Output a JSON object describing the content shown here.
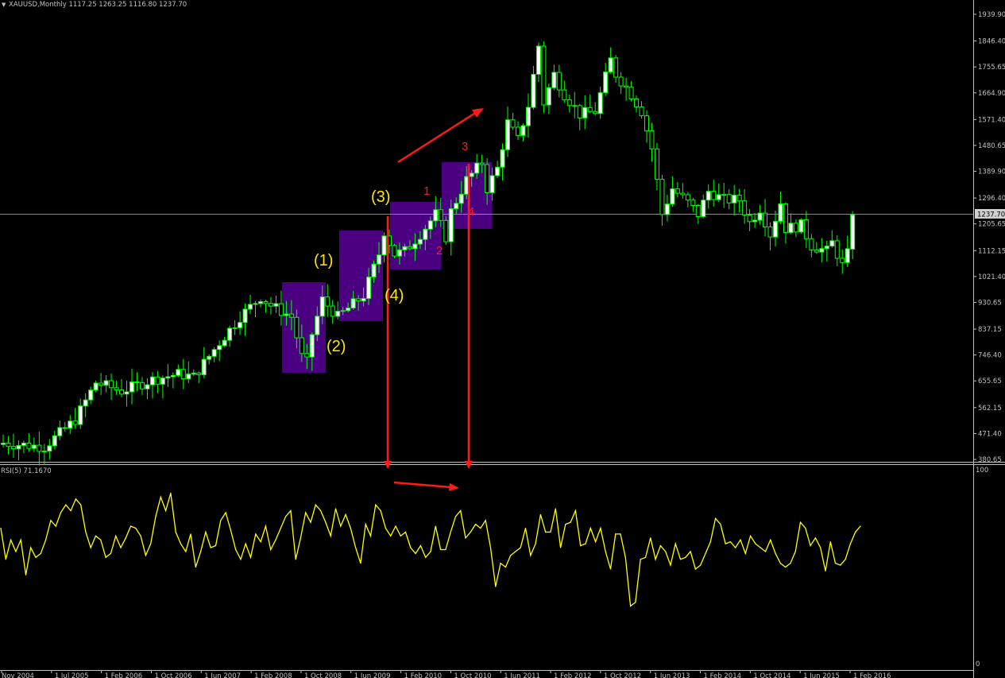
{
  "window": {
    "symbol_header": "XAUUSD,Monthly  1117.25 1263.25 1116.80 1237.70",
    "indicator_header": "RSI(5) 71.1670"
  },
  "colors": {
    "background": "#000000",
    "bull_candle": "#ffffff",
    "bear_candle": "#000000",
    "wick": "#00ff00",
    "rsi_line": "#ffff00",
    "annotation_red": "#ff1a1a",
    "annotation_yellow": "#ffe600",
    "box_fill": "#4b0082",
    "price_line": "#7d8c96",
    "axis": "#c0c0c0"
  },
  "chart_data": [
    {
      "type": "candlestick",
      "title": "XAUUSD,Monthly",
      "last_price": "1237.70",
      "price_labels": [
        "1939.90",
        "1846.40",
        "1755.65",
        "1664.90",
        "1571.40",
        "1480.65",
        "1389.90",
        "1296.40",
        "1205.65",
        "1112.15",
        "1021.40",
        "930.65",
        "837.15",
        "746.40",
        "655.65",
        "562.15",
        "471.40",
        "380.65"
      ],
      "x_labels": [
        "Nov 2004",
        "1 Jul 2005",
        "1 Feb 2006",
        "1 Oct 2006",
        "1 Jun 2007",
        "1 Feb 2008",
        "1 Oct 2008",
        "1 Jun 2009",
        "1 Feb 2010",
        "1 Oct 2010",
        "1 Jun 2011",
        "1 Feb 2012",
        "1 Oct 2012",
        "1 Jun 2013",
        "1 Feb 2014",
        "1 Oct 2014",
        "1 Jun 2015",
        "1 Feb 2016"
      ],
      "close_path": [
        {
          "m": 0,
          "v": 438
        },
        {
          "m": 8,
          "v": 425
        },
        {
          "m": 14,
          "v": 520
        },
        {
          "m": 18,
          "v": 650
        },
        {
          "m": 23,
          "v": 620
        },
        {
          "m": 29,
          "v": 660
        },
        {
          "m": 34,
          "v": 680
        },
        {
          "m": 37,
          "v": 670
        },
        {
          "m": 42,
          "v": 790
        },
        {
          "m": 46,
          "v": 880
        },
        {
          "m": 50,
          "v": 950
        },
        {
          "m": 52,
          "v": 920
        },
        {
          "m": 54,
          "v": 900
        },
        {
          "m": 56,
          "v": 880
        },
        {
          "m": 58,
          "v": 740
        },
        {
          "m": 59,
          "v": 720
        },
        {
          "m": 60,
          "v": 820
        },
        {
          "m": 62,
          "v": 940
        },
        {
          "m": 65,
          "v": 880
        },
        {
          "m": 70,
          "v": 955
        },
        {
          "m": 73,
          "v": 1100
        },
        {
          "m": 74,
          "v": 1180
        },
        {
          "m": 76,
          "v": 1100
        },
        {
          "m": 78,
          "v": 1110
        },
        {
          "m": 81,
          "v": 1170
        },
        {
          "m": 84,
          "v": 1240
        },
        {
          "m": 86,
          "v": 1160
        },
        {
          "m": 87,
          "v": 1250
        },
        {
          "m": 90,
          "v": 1360
        },
        {
          "m": 93,
          "v": 1420
        },
        {
          "m": 94,
          "v": 1330
        },
        {
          "m": 96,
          "v": 1400
        },
        {
          "m": 98,
          "v": 1560
        },
        {
          "m": 100,
          "v": 1500
        },
        {
          "m": 102,
          "v": 1620
        },
        {
          "m": 104,
          "v": 1830
        },
        {
          "m": 105,
          "v": 1630
        },
        {
          "m": 107,
          "v": 1730
        },
        {
          "m": 109,
          "v": 1660
        },
        {
          "m": 112,
          "v": 1590
        },
        {
          "m": 115,
          "v": 1600
        },
        {
          "m": 118,
          "v": 1780
        },
        {
          "m": 119,
          "v": 1730
        },
        {
          "m": 122,
          "v": 1660
        },
        {
          "m": 124,
          "v": 1600
        },
        {
          "m": 126,
          "v": 1470
        },
        {
          "m": 128,
          "v": 1240
        },
        {
          "m": 130,
          "v": 1330
        },
        {
          "m": 133,
          "v": 1280
        },
        {
          "m": 135,
          "v": 1240
        },
        {
          "m": 137,
          "v": 1320
        },
        {
          "m": 140,
          "v": 1290
        },
        {
          "m": 143,
          "v": 1290
        },
        {
          "m": 145,
          "v": 1210
        },
        {
          "m": 147,
          "v": 1260
        },
        {
          "m": 149,
          "v": 1170
        },
        {
          "m": 151,
          "v": 1280
        },
        {
          "m": 152,
          "v": 1190
        },
        {
          "m": 155,
          "v": 1200
        },
        {
          "m": 157,
          "v": 1130
        },
        {
          "m": 160,
          "v": 1110
        },
        {
          "m": 161,
          "v": 1140
        },
        {
          "m": 163,
          "v": 1060
        },
        {
          "m": 164,
          "v": 1100
        },
        {
          "m": 165,
          "v": 1237.7
        }
      ],
      "annotations": {
        "wave_labels_yellow": [
          "(1)",
          "(2)",
          "(3)",
          "(4)"
        ],
        "wave_labels_red": [
          "1",
          "2",
          "3",
          "4"
        ]
      }
    },
    {
      "type": "line",
      "title": "RSI(5) 71.1670",
      "ylim": [
        0,
        100
      ],
      "y_labels": [
        "100",
        "0"
      ],
      "values": [
        70,
        54,
        64,
        58,
        64,
        46,
        60,
        55,
        57,
        64,
        74,
        71,
        78,
        82,
        79,
        85,
        82,
        68,
        60,
        66,
        64,
        55,
        57,
        66,
        60,
        65,
        71,
        70,
        66,
        56,
        62,
        76,
        86,
        79,
        88,
        68,
        62,
        58,
        67,
        50,
        58,
        68,
        60,
        61,
        74,
        78,
        69,
        59,
        54,
        62,
        55,
        67,
        63,
        71,
        59,
        64,
        70,
        76,
        79,
        54,
        65,
        78,
        73,
        82,
        79,
        73,
        66,
        80,
        71,
        77,
        70,
        60,
        52,
        72,
        66,
        82,
        79,
        70,
        66,
        71,
        66,
        68,
        60,
        57,
        61,
        55,
        58,
        71,
        59,
        59,
        68,
        76,
        79,
        65,
        68,
        72,
        70,
        74,
        60,
        40,
        52,
        50,
        56,
        58,
        60,
        70,
        56,
        62,
        77,
        68,
        68,
        80,
        60,
        72,
        73,
        79,
        61,
        62,
        70,
        63,
        70,
        58,
        49,
        67,
        67,
        55,
        30,
        32,
        54,
        55,
        65,
        54,
        61,
        58,
        51,
        62,
        54,
        55,
        58,
        49,
        51,
        57,
        63,
        75,
        72,
        62,
        63,
        60,
        64,
        57,
        66,
        62,
        60,
        58,
        64,
        57,
        52,
        50,
        52,
        58,
        73,
        70,
        61,
        65,
        60,
        48,
        63,
        52,
        51,
        54,
        62,
        68,
        71
      ],
      "annotations": [
        "divergence arrow"
      ]
    }
  ]
}
